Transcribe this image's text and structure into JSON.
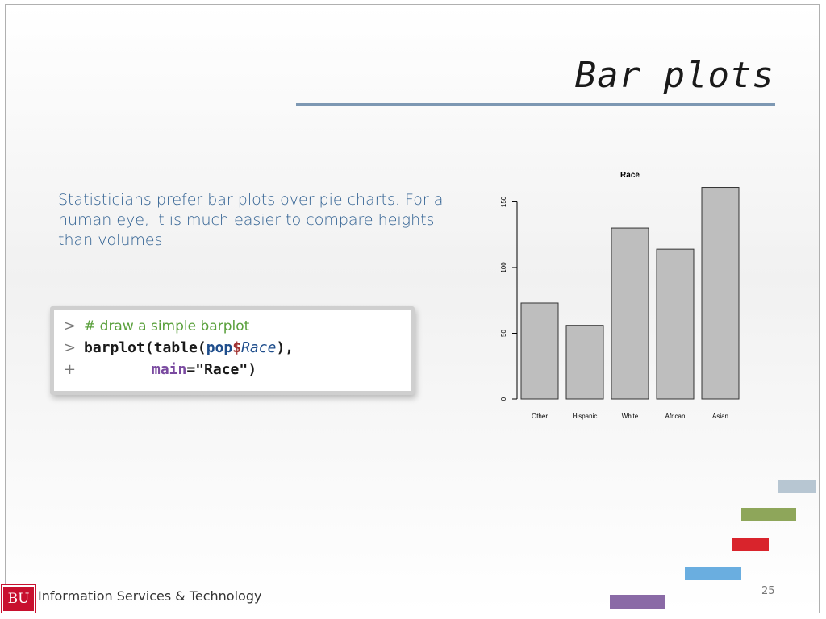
{
  "slide": {
    "title": "Bar plots",
    "body": "Statisticians prefer bar plots over pie charts. For a human eye, it is much easier to compare heights than volumes.",
    "page_number": "25"
  },
  "code": {
    "line1_prompt": ">",
    "line1_comment": "# draw a simple barplot",
    "line2_prompt": ">",
    "line2_fn": "barplot(table(",
    "line2_obj": "pop",
    "line2_dollar": "$",
    "line2_field": "Race",
    "line2_end": "),",
    "line3_prompt": "+",
    "line3_arg": "main",
    "line3_end": "=\"Race\")"
  },
  "footer": {
    "logo": "BU",
    "org": "Information Services & Technology"
  },
  "colors": {
    "title_rule": "#7d98b3",
    "body_text": "#2e5f91",
    "bar_fill": "#bebebe",
    "logo_red": "#c8102e",
    "deco": [
      "#b7c6d2",
      "#8ea65a",
      "#d9242c",
      "#6aaee0",
      "#8a6aa6"
    ]
  },
  "chart_data": {
    "type": "bar",
    "title": "Race",
    "categories": [
      "Other",
      "Hispanic",
      "White",
      "African",
      "Asian"
    ],
    "values": [
      73,
      56,
      130,
      114,
      161
    ],
    "ylim": [
      0,
      165
    ],
    "yticks": [
      "0",
      "50",
      "100",
      "150"
    ],
    "ytick_values": [
      0,
      50,
      100,
      150
    ],
    "grid": false,
    "xlabel": "",
    "ylabel": ""
  }
}
